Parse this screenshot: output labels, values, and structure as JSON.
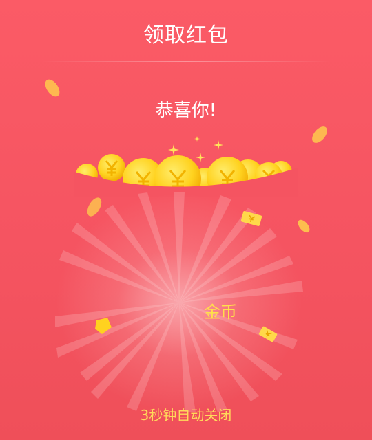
{
  "header": {
    "title": "领取红包"
  },
  "main": {
    "congrats": "恭喜你!",
    "reward_label": "金币",
    "close_hint": "3秒钟自动关闭"
  },
  "colors": {
    "background": "#f55461",
    "coin_gold": "#ffd21f",
    "highlight_yellow": "#ffe04a"
  },
  "icons": [
    "coin-pile-icon",
    "sparkle-icon",
    "falling-coin-icon",
    "falling-money-note-icon"
  ]
}
